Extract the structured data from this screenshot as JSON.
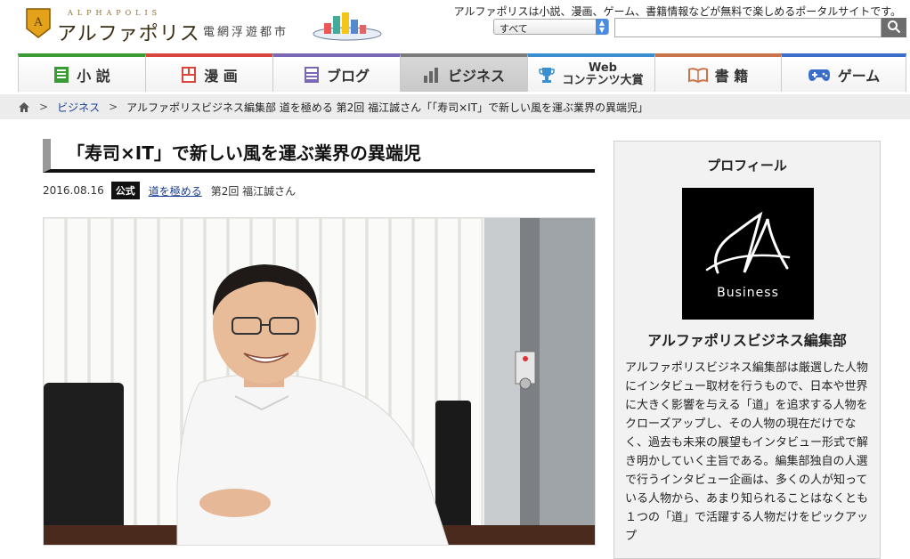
{
  "site": {
    "logo_small": "ALPHAPOLIS",
    "logo_name": "アルファポリス",
    "logo_city": "電網浮遊都市",
    "tagline": "アルファポリスは小説、漫画、ゲーム、書籍情報などが無料で楽しめるポータルサイトです。"
  },
  "search": {
    "category": "すべて",
    "placeholder": ""
  },
  "nav": {
    "tabs": [
      {
        "label": "小 説",
        "icon": "book-icon",
        "color": "#3a9b35"
      },
      {
        "label": "漫 画",
        "icon": "manga-icon",
        "color": "#d9463b"
      },
      {
        "label": "ブログ",
        "icon": "blog-icon",
        "color": "#7a68b5"
      },
      {
        "label": "ビジネス",
        "icon": "chart-icon",
        "color": "#7a7a7a"
      },
      {
        "label_top": "Web",
        "label_bottom": "コンテンツ大賞",
        "icon": "trophy-icon",
        "color": "#3a8fd0"
      },
      {
        "label": "書 籍",
        "icon": "open-book-icon",
        "color": "#c8734a"
      },
      {
        "label": "ゲーム",
        "icon": "gamepad-icon",
        "color": "#3a6ec8"
      }
    ]
  },
  "breadcrumb": {
    "category": "ビジネス",
    "current": "アルファポリスビジネス編集部 道を極める 第2回 福江誠さん「「寿司×IT」で新しい風を運ぶ業界の異端児」"
  },
  "article": {
    "title": "「寿司×IT」で新しい風を運ぶ業界の異端児",
    "date": "2016.08.16",
    "badge": "公式",
    "series": "道を極める",
    "episode": "第2回 福江誠さん"
  },
  "profile": {
    "heading": "プロフィール",
    "logo_text": "Business",
    "name": "アルファポリスビジネス編集部",
    "description": "アルファポリスビジネス編集部は厳選した人物にインタビュー取材を行うもので、日本や世界に大きく影響を与える「道」を追求する人物をクローズアップし、その人物の現在だけでなく、過去も未来の展望もインタビュー形式で解き明かしていく主旨である。編集部独自の人選で行うインタビュー企画は、多くの人が知っている人物から、あまり知られることはなくとも１つの「道」で活躍する人物だけをピックアップ"
  }
}
